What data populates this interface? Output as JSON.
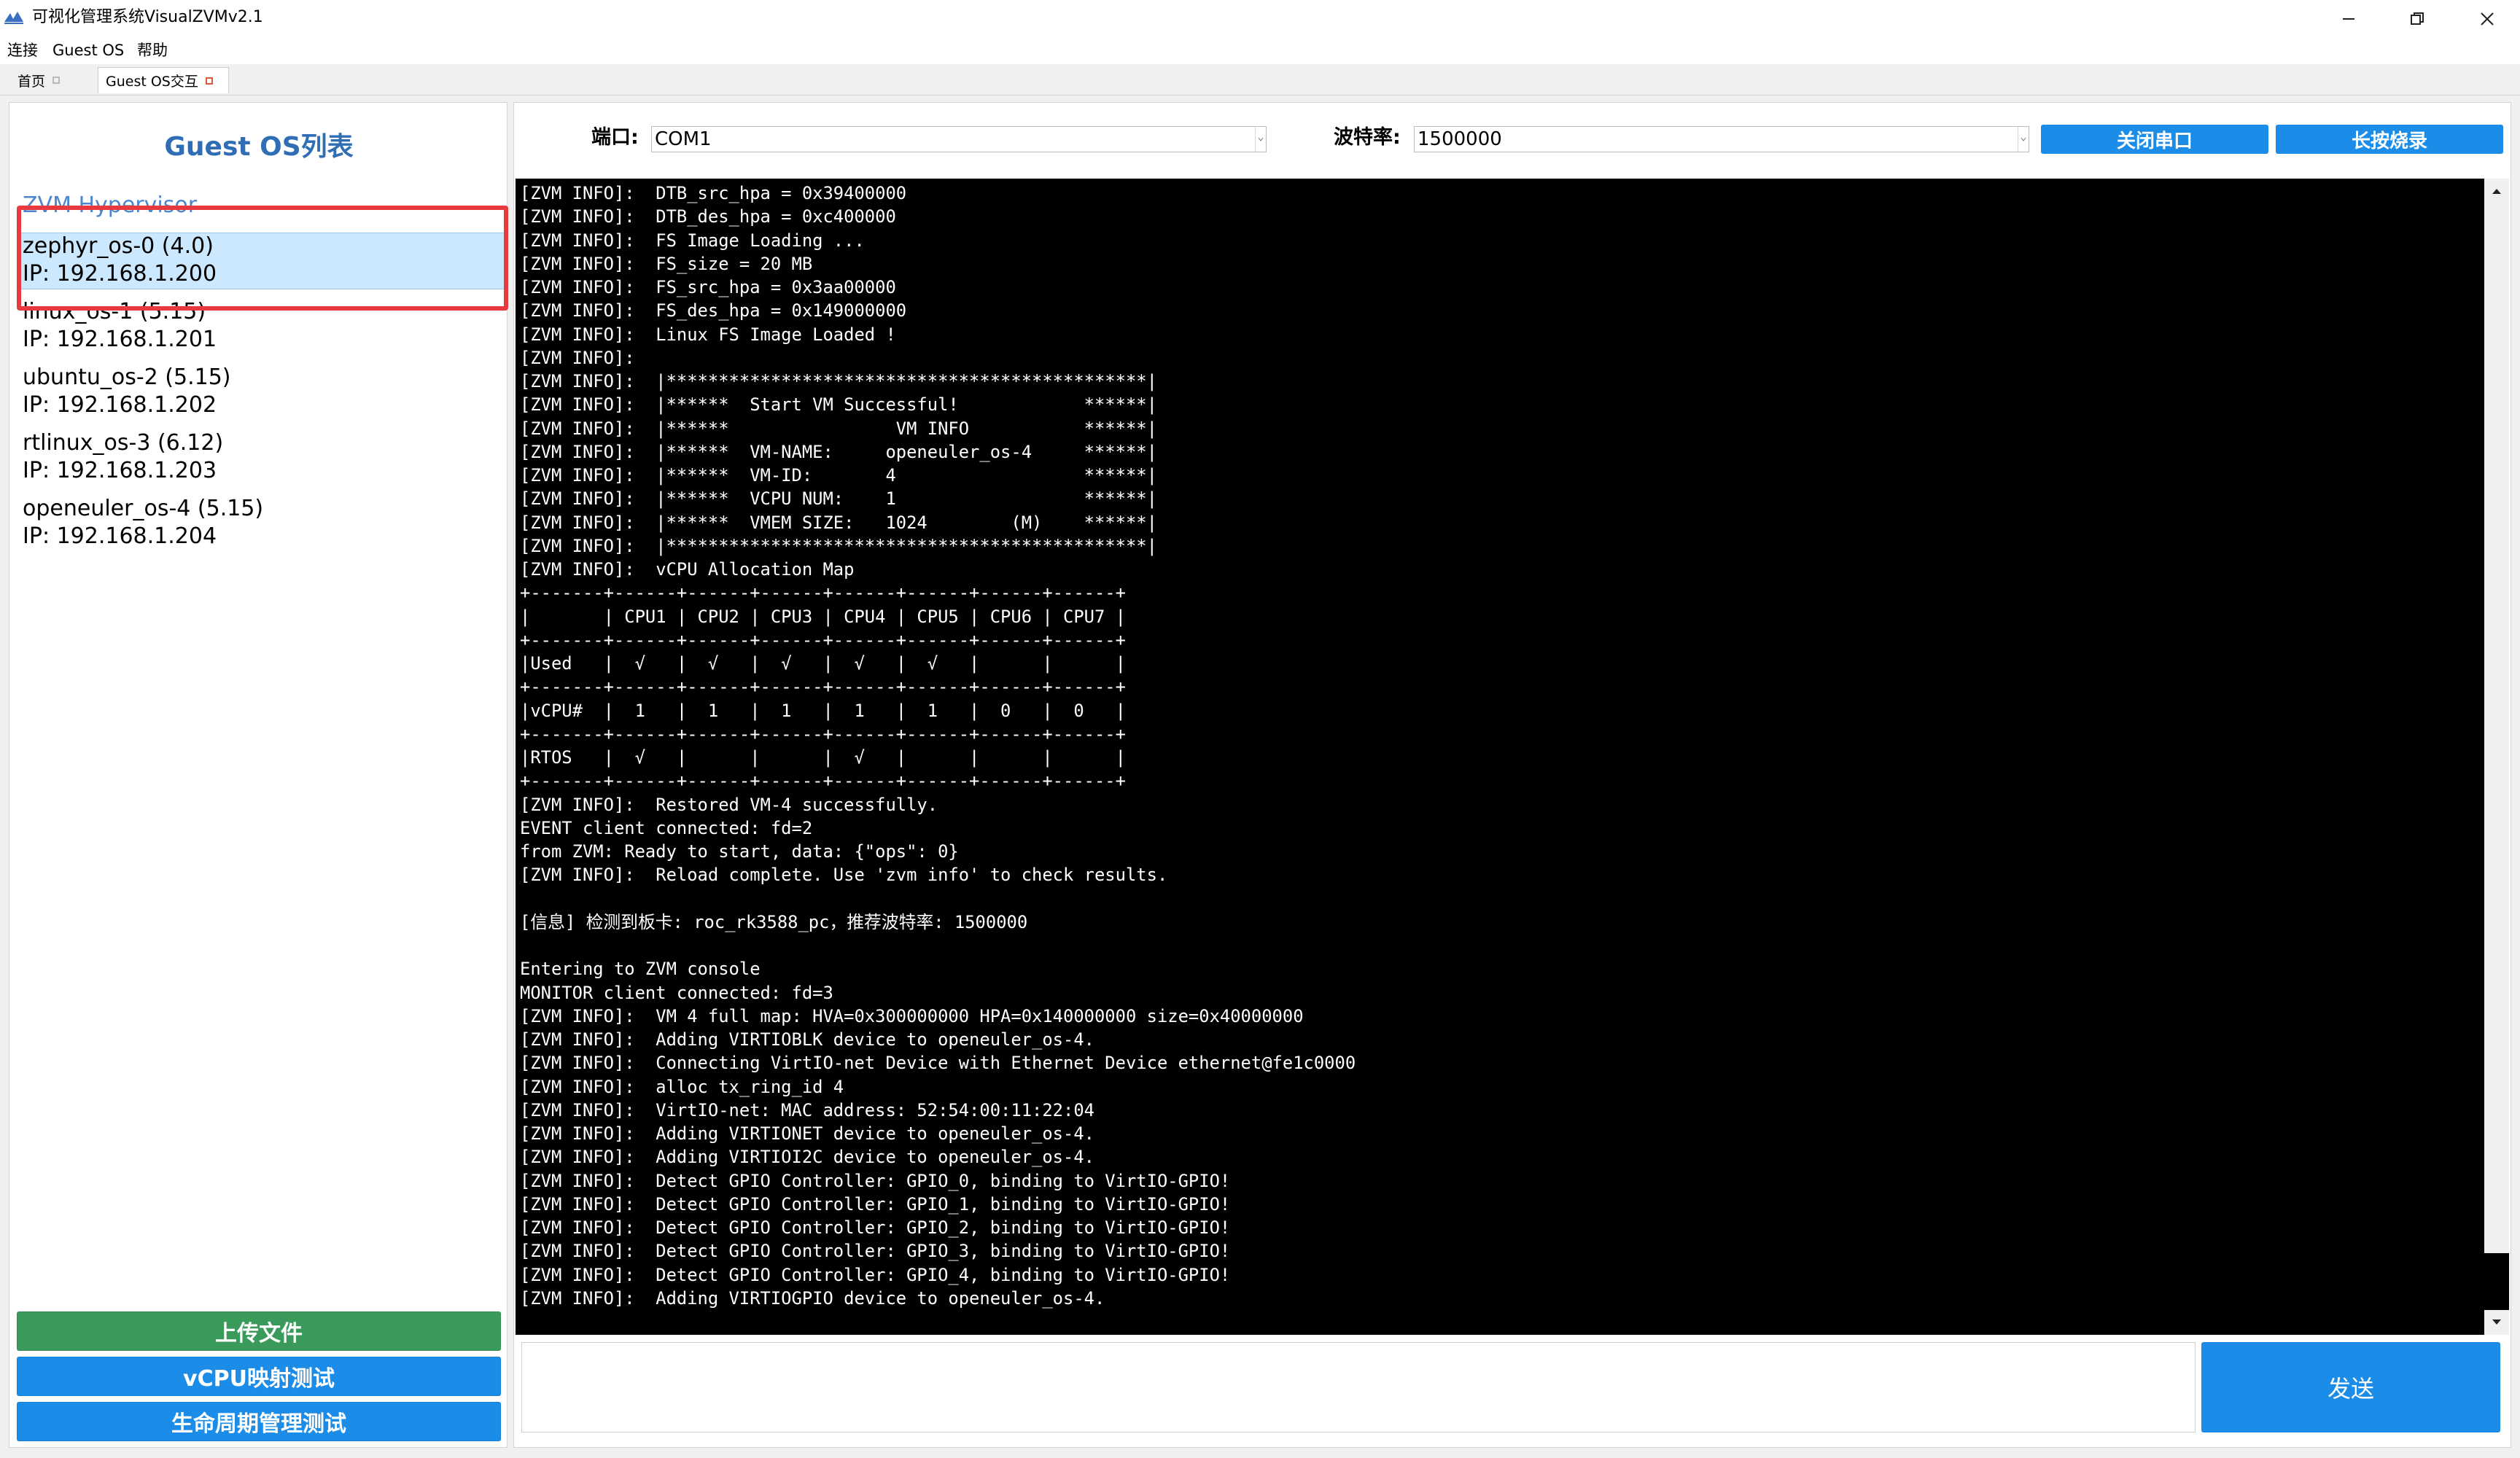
{
  "window": {
    "title": "可视化管理系统VisualZVMv2.1"
  },
  "menu": {
    "items": [
      {
        "label": "连接"
      },
      {
        "label": "Guest OS"
      },
      {
        "label": "帮助"
      }
    ]
  },
  "tabs": [
    {
      "label": "首页",
      "active": false
    },
    {
      "label": "Guest OS交互",
      "active": true
    }
  ],
  "left_panel": {
    "title": "Guest OS列表",
    "hypervisor_label": "ZVM Hypervisor",
    "os_list": [
      {
        "name": "zephyr_os-0 (4.0)",
        "ip": "IP: 192.168.1.200",
        "selected": true
      },
      {
        "name": "linux_os-1 (5.15)",
        "ip": "IP: 192.168.1.201",
        "selected": false
      },
      {
        "name": "ubuntu_os-2 (5.15)",
        "ip": "IP: 192.168.1.202",
        "selected": false
      },
      {
        "name": "rtlinux_os-3 (6.12)",
        "ip": "IP: 192.168.1.203",
        "selected": false
      },
      {
        "name": "openeuler_os-4 (5.15)",
        "ip": "IP: 192.168.1.204",
        "selected": false
      }
    ],
    "buttons": {
      "upload": "上传文件",
      "vcpu_test": "vCPU映射测试",
      "lifecycle_test": "生命周期管理测试"
    }
  },
  "serial": {
    "port_label": "端口:",
    "port_value": "COM1",
    "baud_label": "波特率:",
    "baud_value": "1500000",
    "close_button": "关闭串口",
    "flash_button": "长按烧录"
  },
  "console": {
    "lines": [
      "[ZVM INFO]:  DTB_src_hpa = 0x39400000",
      "[ZVM INFO]:  DTB_des_hpa = 0xc400000",
      "[ZVM INFO]:  FS Image Loading ...",
      "[ZVM INFO]:  FS_size = 20 MB",
      "[ZVM INFO]:  FS_src_hpa = 0x3aa00000",
      "[ZVM INFO]:  FS_des_hpa = 0x149000000",
      "[ZVM INFO]:  Linux FS Image Loaded !",
      "[ZVM INFO]:",
      "[ZVM INFO]:  |**********************************************|",
      "[ZVM INFO]:  |******  Start VM Successful!            ******|",
      "[ZVM INFO]:  |******                VM INFO           ******|",
      "[ZVM INFO]:  |******  VM-NAME:     openeuler_os-4     ******|",
      "[ZVM INFO]:  |******  VM-ID:       4                  ******|",
      "[ZVM INFO]:  |******  VCPU NUM:    1                  ******|",
      "[ZVM INFO]:  |******  VMEM SIZE:   1024        (M)    ******|",
      "[ZVM INFO]:  |**********************************************|",
      "[ZVM INFO]:  vCPU Allocation Map",
      "+-------+------+------+------+------+------+------+------+",
      "|       | CPU1 | CPU2 | CPU3 | CPU4 | CPU5 | CPU6 | CPU7 |",
      "+-------+------+------+------+------+------+------+------+",
      "|Used   |  √   |  √   |  √   |  √   |  √   |      |      |",
      "+-------+------+------+------+------+------+------+------+",
      "|vCPU#  |  1   |  1   |  1   |  1   |  1   |  0   |  0   |",
      "+-------+------+------+------+------+------+------+------+",
      "|RTOS   |  √   |      |      |  √   |      |      |      |",
      "+-------+------+------+------+------+------+------+------+",
      "[ZVM INFO]:  Restored VM-4 successfully.",
      "EVENT client connected: fd=2",
      "from ZVM: Ready to start, data: {\"ops\": 0}",
      "[ZVM INFO]:  Reload complete. Use 'zvm info' to check results.",
      "",
      "[信息] 检测到板卡: roc_rk3588_pc，推荐波特率: 1500000",
      "",
      "Entering to ZVM console",
      "MONITOR client connected: fd=3",
      "[ZVM INFO]:  VM 4 full map: HVA=0x300000000 HPA=0x140000000 size=0x40000000",
      "[ZVM INFO]:  Adding VIRTIOBLK device to openeuler_os-4.",
      "[ZVM INFO]:  Connecting VirtIO-net Device with Ethernet Device ethernet@fe1c0000",
      "[ZVM INFO]:  alloc tx_ring_id 4",
      "[ZVM INFO]:  VirtIO-net: MAC address: 52:54:00:11:22:04",
      "[ZVM INFO]:  Adding VIRTIONET device to openeuler_os-4.",
      "[ZVM INFO]:  Adding VIRTIOI2C device to openeuler_os-4.",
      "[ZVM INFO]:  Detect GPIO Controller: GPIO_0, binding to VirtIO-GPIO!",
      "[ZVM INFO]:  Detect GPIO Controller: GPIO_1, binding to VirtIO-GPIO!",
      "[ZVM INFO]:  Detect GPIO Controller: GPIO_2, binding to VirtIO-GPIO!",
      "[ZVM INFO]:  Detect GPIO Controller: GPIO_3, binding to VirtIO-GPIO!",
      "[ZVM INFO]:  Detect GPIO Controller: GPIO_4, binding to VirtIO-GPIO!",
      "[ZVM INFO]:  Adding VIRTIOGPIO device to openeuler_os-4."
    ]
  },
  "send": {
    "input_value": "",
    "button_label": "发送"
  },
  "colors": {
    "accent_blue": "#1b8ce8",
    "upload_green": "#3a9a5b",
    "title_blue": "#2f6db5",
    "highlight_red": "#e8393e",
    "selected_bg": "#cce8ff"
  },
  "icons": {
    "app": "app-logo-icon",
    "minimize": "minimize-icon",
    "maximize": "restore-icon",
    "close": "close-icon"
  }
}
